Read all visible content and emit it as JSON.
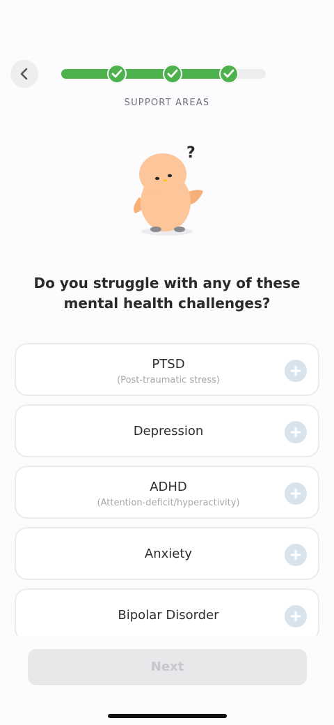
{
  "header": {
    "back_icon": "chevron-left-icon",
    "progress": {
      "completed_steps": 3,
      "total_steps": 3.7,
      "fill_fraction": 0.88
    },
    "step_title": "SUPPORT AREAS"
  },
  "illustration": {
    "name": "mascot-confused",
    "question_mark": "?"
  },
  "question": {
    "line1": "Do you struggle with any of these",
    "line2": "mental health challenges?"
  },
  "options": [
    {
      "label": "PTSD",
      "sub": "(Post-traumatic stress)",
      "icon": "plus-icon"
    },
    {
      "label": "Depression",
      "sub": "",
      "icon": "plus-icon"
    },
    {
      "label": "ADHD",
      "sub": "(Attention-deficit/hyperactivity)",
      "icon": "plus-icon"
    },
    {
      "label": "Anxiety",
      "sub": "",
      "icon": "plus-icon"
    },
    {
      "label": "Bipolar Disorder",
      "sub": "",
      "icon": "plus-icon"
    }
  ],
  "footer": {
    "next_label": "Next",
    "next_enabled": false
  },
  "colors": {
    "progress_green": "#4db14d",
    "plus_bg": "#d9e3ec",
    "button_disabled_bg": "#e8e8ea",
    "button_disabled_text": "#c8c8cc"
  }
}
